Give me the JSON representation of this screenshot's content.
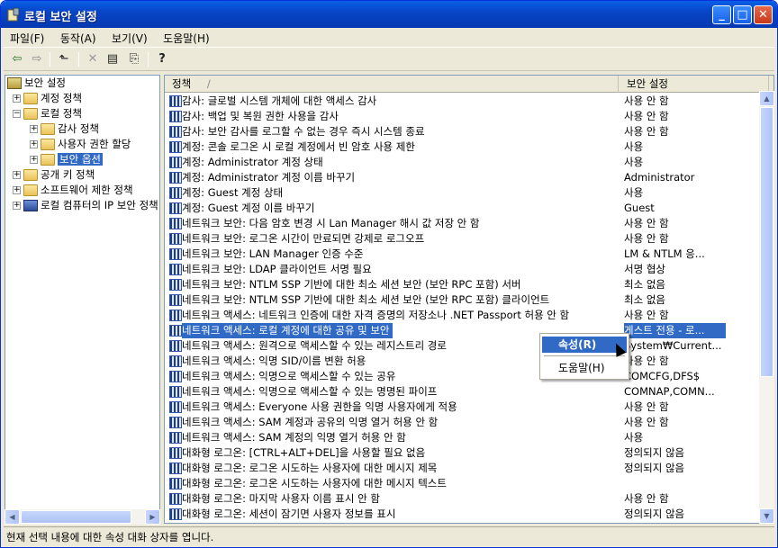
{
  "window": {
    "title": "로컬 보안 설정"
  },
  "titlebar_buttons": {
    "minimize": "_",
    "maximize": "□",
    "close": "✕"
  },
  "menu": [
    {
      "label": "파일(F)"
    },
    {
      "label": "동작(A)"
    },
    {
      "label": "보기(V)"
    },
    {
      "label": "도움말(H)"
    }
  ],
  "toolbar": [
    {
      "icon": "back-arrow-icon",
      "glyph": "⇦"
    },
    {
      "icon": "forward-arrow-icon",
      "glyph": "⇨"
    },
    {
      "icon": "up-folder-icon",
      "glyph": "⬑"
    },
    {
      "icon": "delete-icon",
      "glyph": "✕"
    },
    {
      "icon": "properties-icon",
      "glyph": "▤"
    },
    {
      "icon": "export-list-icon",
      "glyph": "⎘"
    },
    {
      "icon": "help-icon",
      "glyph": "?"
    }
  ],
  "tree": [
    {
      "label": "보안 설정",
      "level": 0,
      "expander": "",
      "selected": false
    },
    {
      "label": "계정 정책",
      "level": 1,
      "expander": "+",
      "selected": false
    },
    {
      "label": "로컬 정책",
      "level": 1,
      "expander": "−",
      "selected": false
    },
    {
      "label": "감사 정책",
      "level": 2,
      "expander": "+",
      "selected": false
    },
    {
      "label": "사용자 권한 할당",
      "level": 2,
      "expander": "+",
      "selected": false
    },
    {
      "label": "보안 옵션",
      "level": 2,
      "expander": "+",
      "selected": true
    },
    {
      "label": "공개 키 정책",
      "level": 1,
      "expander": "+",
      "selected": false
    },
    {
      "label": "소프트웨어 제한 정책",
      "level": 1,
      "expander": "+",
      "selected": false
    },
    {
      "label": "로컬 컴퓨터의 IP 보안 정책",
      "level": 1,
      "expander": "+",
      "selected": false
    }
  ],
  "list": {
    "columns": {
      "policy": "정책",
      "sort_indicator": "/",
      "setting": "보안 설정"
    },
    "rows": [
      {
        "policy": "감사: 글로벌 시스템 개체에 대한 액세스 감사",
        "setting": "사용 안 함"
      },
      {
        "policy": "감사: 백업 및 복원 권한 사용을 감사",
        "setting": "사용 안 함"
      },
      {
        "policy": "감사: 보안 감사를 로그할 수 없는 경우 즉시 시스템 종료",
        "setting": "사용 안 함"
      },
      {
        "policy": "계정: 콘솔 로그온 시 로컬 계정에서 빈 암호 사용 제한",
        "setting": "사용"
      },
      {
        "policy": "계정: Administrator 계정 상태",
        "setting": "사용"
      },
      {
        "policy": "계정: Administrator 계정 이름 바꾸기",
        "setting": "Administrator"
      },
      {
        "policy": "계정: Guest 계정 상태",
        "setting": "사용"
      },
      {
        "policy": "계정: Guest 계정 이름 바꾸기",
        "setting": "Guest"
      },
      {
        "policy": "네트워크 보안: 다음 암호 변경 시 Lan Manager 해시 값 저장 안 함",
        "setting": "사용 안 함"
      },
      {
        "policy": "네트워크 보안: 로그온 시간이 만료되면 강제로 로그오프",
        "setting": "사용 안 함"
      },
      {
        "policy": "네트워크 보안: LAN Manager 인증 수준",
        "setting": "LM & NTLM 응..."
      },
      {
        "policy": "네트워크 보안: LDAP 클라이언트 서명 필요",
        "setting": "서명 협상"
      },
      {
        "policy": "네트워크 보안: NTLM SSP 기반에 대한 최소 세션 보안 (보안 RPC 포함) 서버",
        "setting": "최소 없음"
      },
      {
        "policy": "네트워크 보안: NTLM SSP 기반에 대한 최소 세션 보안 (보안 RPC 포함) 클라이언트",
        "setting": "최소 없음"
      },
      {
        "policy": "네트워크 액세스: 네트워크 인증에 대한 자격 증명의 저장소나 .NET Passport 허용 안 함",
        "setting": "사용 안 함"
      },
      {
        "policy": "네트워크 액세스: 로컬 계정에 대한 공유 및 보안",
        "setting": "게스트 전용 - 로...",
        "highlighted": true
      },
      {
        "policy": "네트워크 액세스: 원격으로 액세스할 수 있는 레지스트리 경로",
        "setting": "System₩Current..."
      },
      {
        "policy": "네트워크 액세스: 익명 SID/이름 변환 허용",
        "setting": "사용 안 함"
      },
      {
        "policy": "네트워크 액세스: 익명으로 액세스할 수 있는 공유",
        "setting": "COMCFG,DFS$"
      },
      {
        "policy": "네트워크 액세스: 익명으로 액세스할 수 있는 명명된 파이프",
        "setting": "COMNAP,COMN..."
      },
      {
        "policy": "네트워크 액세스: Everyone 사용 권한을 익명 사용자에게 적용",
        "setting": "사용 안 함"
      },
      {
        "policy": "네트워크 액세스: SAM 계정과 공유의 익명 열거 허용 안 함",
        "setting": "사용 안 함"
      },
      {
        "policy": "네트워크 액세스: SAM 계정의 익명 열거 허용 안 함",
        "setting": "사용"
      },
      {
        "policy": "대화형 로그온: [CTRL+ALT+DEL]을 사용할 필요 없음",
        "setting": "정의되지 않음"
      },
      {
        "policy": "대화형 로그온: 로그온 시도하는 사용자에 대한 메시지 제목",
        "setting": "정의되지 않음"
      },
      {
        "policy": "대화형 로그온: 로그온 시도하는 사용자에 대한 메시지 텍스트",
        "setting": ""
      },
      {
        "policy": "대화형 로그온: 마지막 사용자 이름 표시 안 함",
        "setting": "사용 안 함"
      },
      {
        "policy": "대화형 로그온: 세션이 잠기면 사용자 정보를 표시",
        "setting": "정의되지 않음"
      }
    ]
  },
  "context_menu": {
    "items": [
      {
        "label": "속성(R)",
        "active": true
      },
      {
        "label": "도움말(H)",
        "active": false
      }
    ]
  },
  "statusbar": {
    "text": "현재 선택 내용에 대한 속성 대화 상자를 엽니다."
  }
}
